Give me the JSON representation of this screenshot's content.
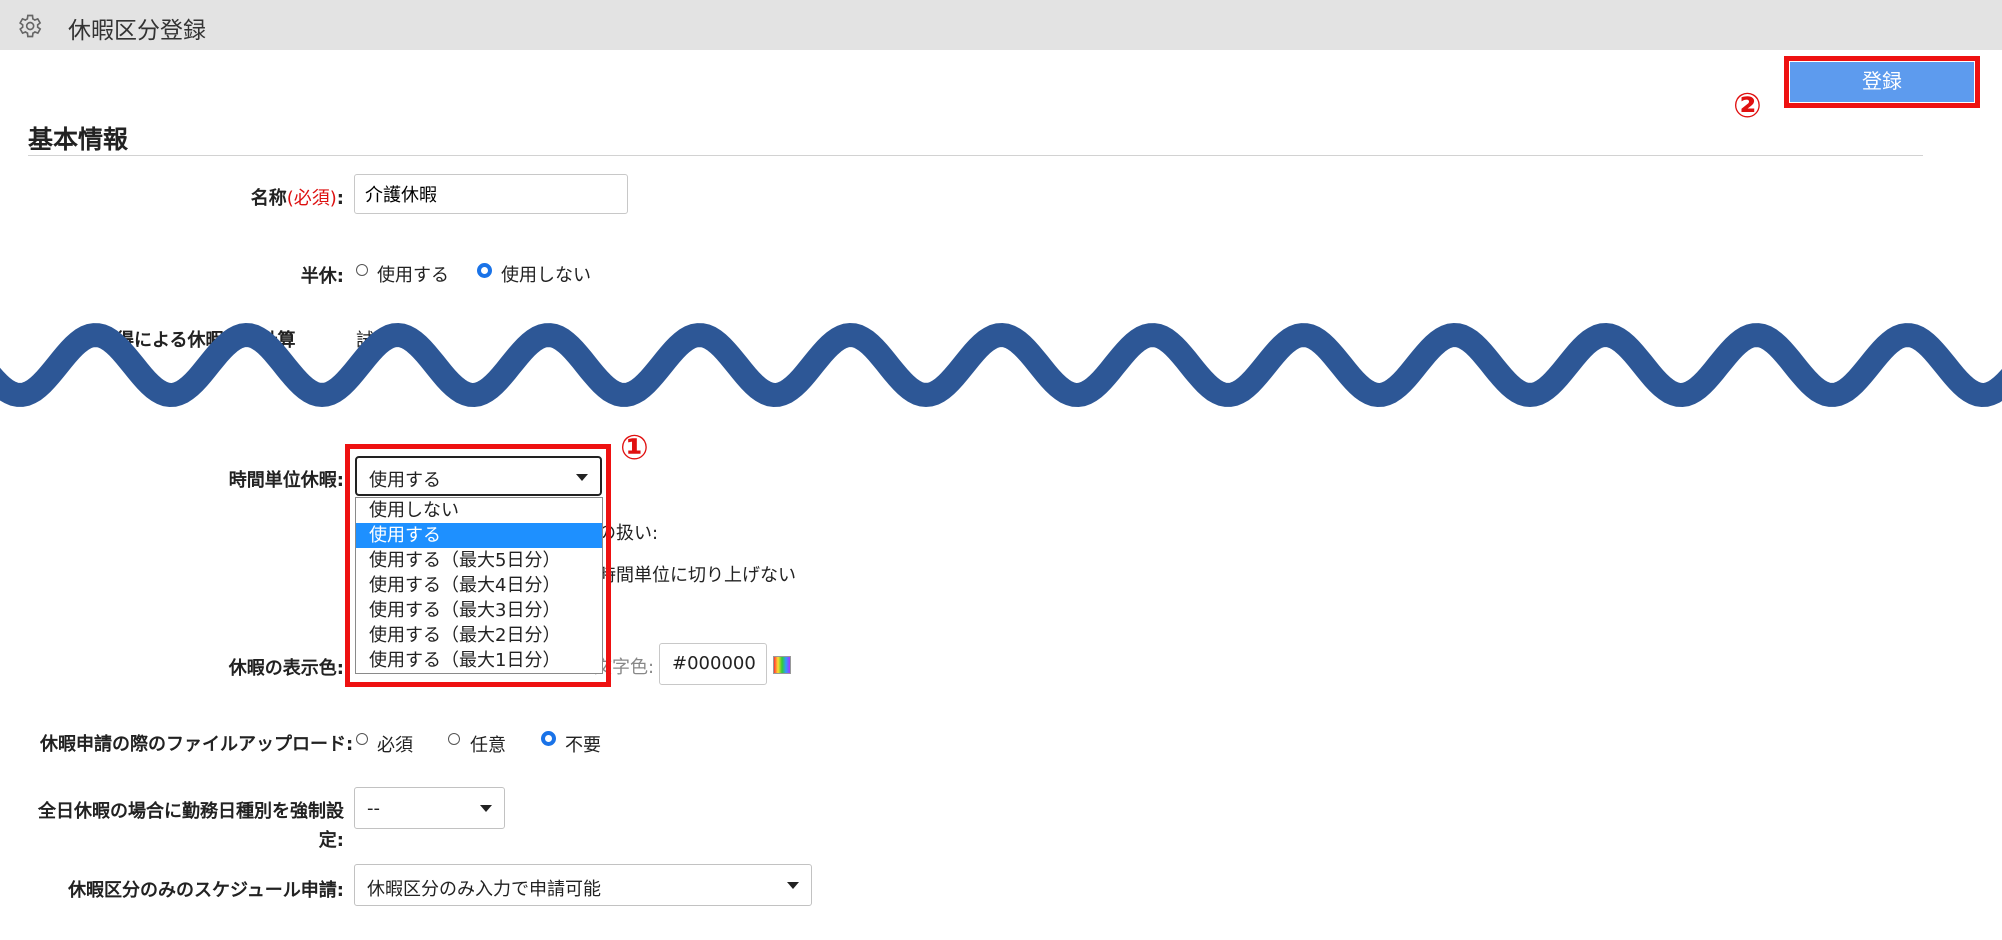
{
  "header": {
    "title": "休暇区分登録",
    "icon": "gear-icon"
  },
  "actions": {
    "register_label": "登録",
    "marker": "②"
  },
  "section": {
    "title": "基本情報"
  },
  "form": {
    "name": {
      "label": "名称",
      "required": "(必須)",
      "colon": ":",
      "value": "介護休暇"
    },
    "half_day": {
      "label": "半休:",
      "options": [
        "使用する",
        "使用しない"
      ],
      "selected": "使用しない"
    },
    "calc": {
      "label_visible": "得による休暇数の計算",
      "trailing_visible": "試算"
    },
    "hourly_leave": {
      "label": "時間単位休暇:",
      "value": "使用する",
      "marker": "①",
      "options": [
        "使用しない",
        "使用する",
        "使用する（最大5日分）",
        "使用する（最大4日分）",
        "使用する（最大3日分）",
        "使用する（最大2日分）",
        "使用する（最大1日分）"
      ],
      "selected_index": 1,
      "behind_text_1": "の扱い:",
      "behind_text_2": "時間単位に切り上げない"
    },
    "display_color": {
      "label": "休暇の表示色:",
      "text_color_label": "文字色:",
      "text_color_value": "#000000"
    },
    "file_upload": {
      "label": "休暇申請の際のファイルアップロード:",
      "options": [
        "必須",
        "任意",
        "不要"
      ],
      "selected": "不要"
    },
    "force_workday": {
      "label_line1": "全日休暇の場合に勤務日種別を強制設",
      "label_line2": "定:",
      "value": "--"
    },
    "schedule_request": {
      "label": "休暇区分のみのスケジュール申請:",
      "value": "休暇区分のみ入力で申請可能"
    }
  },
  "colors": {
    "accent": "#5d9bee",
    "highlight": "#ee1111",
    "wave": "#2d5796",
    "selected_option": "#1e90ff",
    "radio": "#1a73e8"
  }
}
